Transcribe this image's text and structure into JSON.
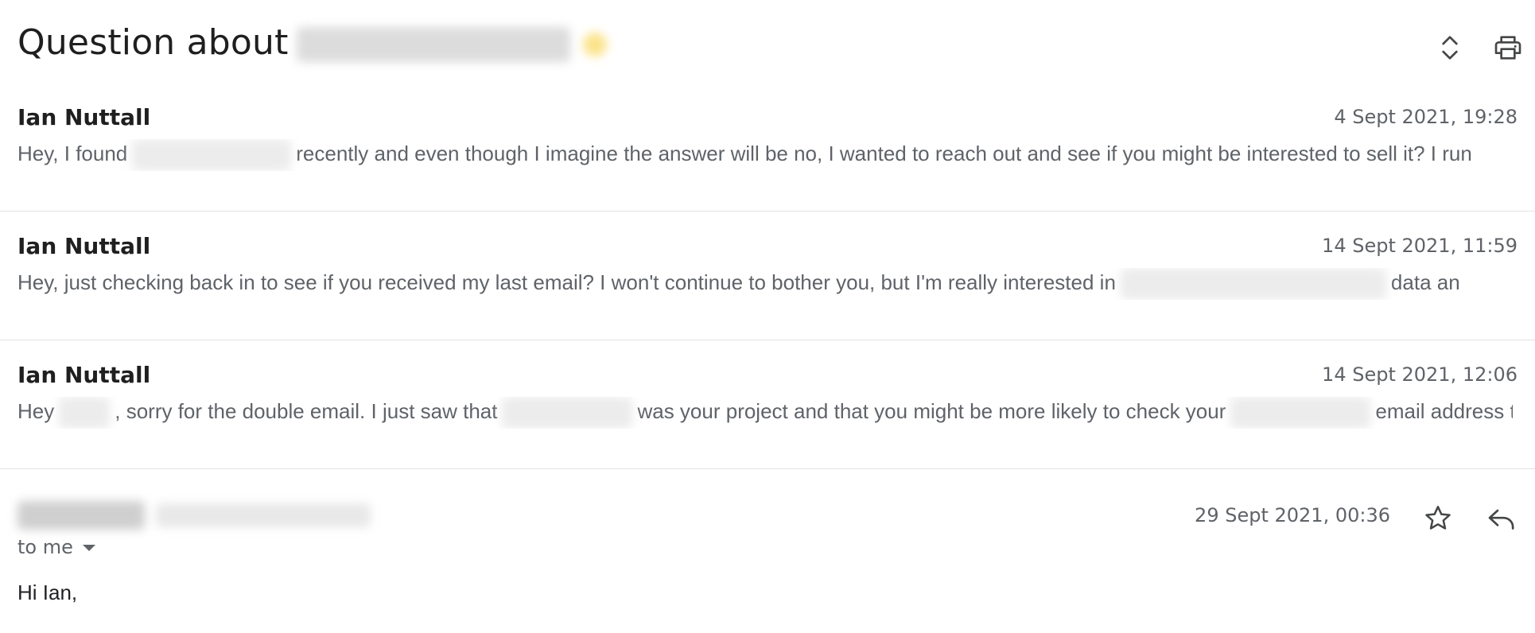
{
  "thread": {
    "subject": "Question about"
  },
  "messages": [
    {
      "sender": "Ian Nuttall",
      "date": "4 Sept 2021, 19:28",
      "snippet_parts": [
        "Hey, I found",
        "recently and even though I imagine the answer will be no, I wanted to reach out and see if you might be interested to sell it? I run"
      ]
    },
    {
      "sender": "Ian Nuttall",
      "date": "14 Sept 2021, 11:59",
      "snippet_parts": [
        "Hey, just checking back in to see if you received my last email? I won't continue to bother you, but I'm really interested in",
        "data an"
      ]
    },
    {
      "sender": "Ian Nuttall",
      "date": "14 Sept 2021, 12:06",
      "snippet_parts": [
        "Hey",
        ", sorry for the double email. I just saw that",
        "was your project and that you might be more likely to check your",
        "email address t"
      ]
    }
  ],
  "open_message": {
    "recipient_label": "to me",
    "date": "29 Sept 2021, 00:36",
    "body": "Hi Ian,"
  },
  "icons": {
    "expand": "unfold-more-icon",
    "print": "print-icon",
    "star": "star-outline-icon",
    "reply": "reply-icon",
    "recipient_menu": "caret-down-icon"
  }
}
